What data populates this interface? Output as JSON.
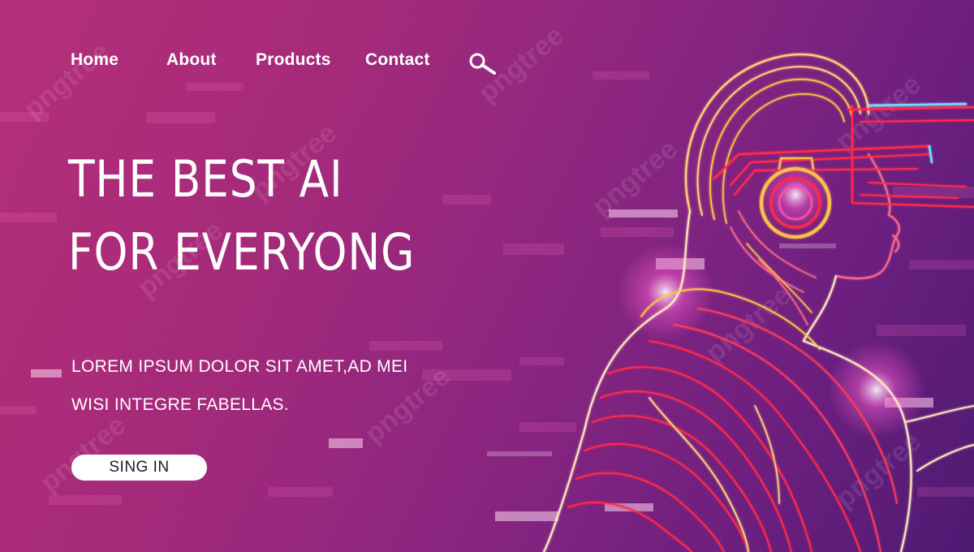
{
  "nav": {
    "items": [
      "Home",
      "About",
      "Products",
      "Contact"
    ],
    "search_icon": "search-icon"
  },
  "hero": {
    "title_line1": "THE BEST AI",
    "title_line2": "FOR EVERYONG",
    "subtitle_line1": "LOREM IPSUM DOLOR SIT AMET,AD MEI",
    "subtitle_line2": "WISI INTEGRE FABELLAS.",
    "button_label": "SING IN"
  },
  "watermark": "pngtree",
  "colors": {
    "background_start": "#b52f79",
    "background_end": "#4e1a72",
    "text": "#ffffff",
    "button_bg": "#ffffff",
    "neon_red": "#ff2a4a",
    "neon_gold": "#ffc04a",
    "neon_cyan": "#6fe0ff"
  }
}
